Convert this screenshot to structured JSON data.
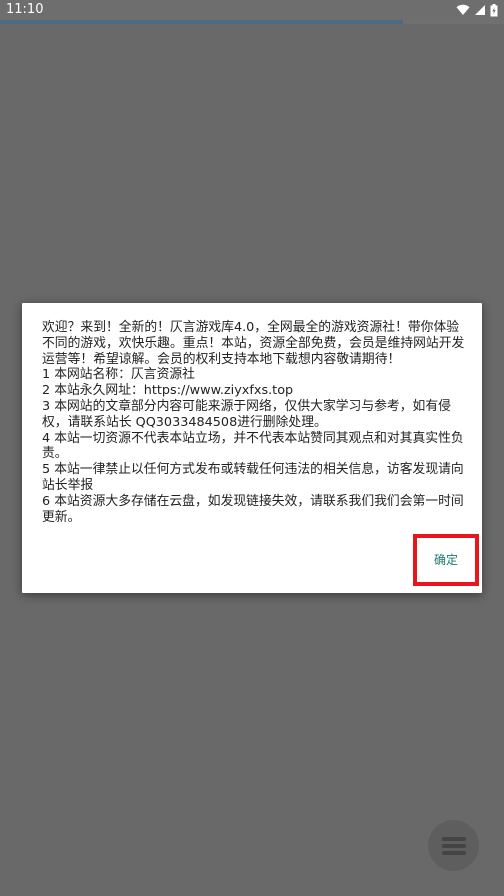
{
  "status_bar": {
    "time": "11:10",
    "icons": [
      "wifi-icon",
      "signal-icon",
      "battery-icon"
    ]
  },
  "load_progress": {
    "percent": 80,
    "color": "#4e6a85"
  },
  "dialog": {
    "lines": [
      "欢迎？来到！全新的！仄言游戏库4.0，全网最全的游戏资源社！带你体验不同的游戏，欢快乐趣。重点！本站，资源全部免费，会员是维持网站开发运营等！希望谅解。会员的权利支持本地下载想内容敬请期待！",
      "1 本网站名称：仄言资源社",
      "2 本站永久网址：https://www.ziyxfxs.top",
      "3 本网站的文章部分内容可能来源于网络，仅供大家学习与参考，如有侵权，请联系站长 QQ3033484508进行删除处理。",
      "4 本站一切资源不代表本站立场，并不代表本站赞同其观点和对其真实性负责。",
      "5 本站一律禁止以任何方式发布或转载任何违法的相关信息，访客发现请向站长举报",
      "6 本站资源大多存储在云盘，如发现链接失效，请联系我们我们会第一时间更新。"
    ],
    "confirm_label": "确定",
    "confirm_color": "#1b7a6e",
    "highlight_color": "#e8151c"
  },
  "fab": {
    "icon": "menu-icon"
  }
}
